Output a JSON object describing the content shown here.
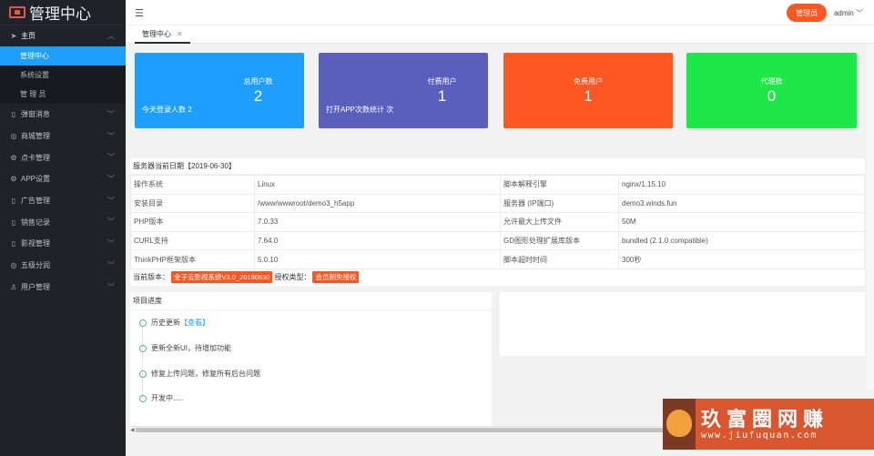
{
  "app": {
    "logo_text": "管理中心"
  },
  "sidebar": {
    "main": {
      "label": "主页",
      "icon": "send-icon"
    },
    "sub_items": [
      {
        "label": "管理中心",
        "active": true
      },
      {
        "label": "系统设置"
      },
      {
        "label": "管 理 员"
      }
    ],
    "items": [
      {
        "label": "弹窗消息",
        "icon": "phone-icon"
      },
      {
        "label": "商城管理",
        "icon": "compass-icon"
      },
      {
        "label": "点卡管理",
        "icon": "gear-icon"
      },
      {
        "label": "APP设置",
        "icon": "gear-icon"
      },
      {
        "label": "广告管理",
        "icon": "phone-icon"
      },
      {
        "label": "销售记录",
        "icon": "phone-icon"
      },
      {
        "label": "影视管理",
        "icon": "phone-icon"
      },
      {
        "label": "五级分润",
        "icon": "compass-icon"
      },
      {
        "label": "用户管理",
        "icon": "user-icon"
      }
    ]
  },
  "header": {
    "role_button": "管理员",
    "user": "admin"
  },
  "tabs": [
    {
      "label": "管理中心"
    }
  ],
  "cards": [
    {
      "label": "总用户数",
      "value": "2",
      "extra": "今天登录人数 2",
      "color": "#1e9fff"
    },
    {
      "label": "付费用户",
      "value": "1",
      "extra": "打开APP次数统计 次",
      "color": "#5a5fbd"
    },
    {
      "label": "免费用户",
      "value": "1",
      "extra": "",
      "color": "#ff5722"
    },
    {
      "label": "代理数",
      "value": "0",
      "extra": "",
      "color": "#1ee847"
    }
  ],
  "server": {
    "title": "服务器当前日期【2019-06-30】",
    "rows": [
      [
        "操作系统",
        "Linux",
        "脚本解释引擎",
        "nginx/1.15.10"
      ],
      [
        "安装目录",
        "/www/wwwroot/demo3_h5app",
        "服务器 (IP端口)",
        "demo3.winds.fun"
      ],
      [
        "PHP版本",
        "7.0.33",
        "允许最大上传文件",
        "50M"
      ],
      [
        "CURL支持",
        "7.64.0",
        "GD图形处理扩展库版本",
        "bundled (2.1.0 compatible)"
      ],
      [
        "ThinkPHP框架版本",
        "5.0.10",
        "脚本超时时间",
        "300秒"
      ]
    ],
    "version_label": "当前版本：",
    "version_tag": "金子云影视系统V3.0_20190630",
    "license_label": "授权类型：",
    "license_tag": "会员制免授权"
  },
  "progress": {
    "title": "项目进度",
    "items": [
      {
        "text": "历史更新",
        "link": "【查看】"
      },
      {
        "text": "更新全新UI，待增加功能"
      },
      {
        "text": "修复上传问题，修复所有后台问题"
      },
      {
        "text": "开发中....."
      }
    ]
  },
  "watermark": {
    "cn": "玖富圈网赚",
    "url": "www.jiufuquan.com"
  }
}
